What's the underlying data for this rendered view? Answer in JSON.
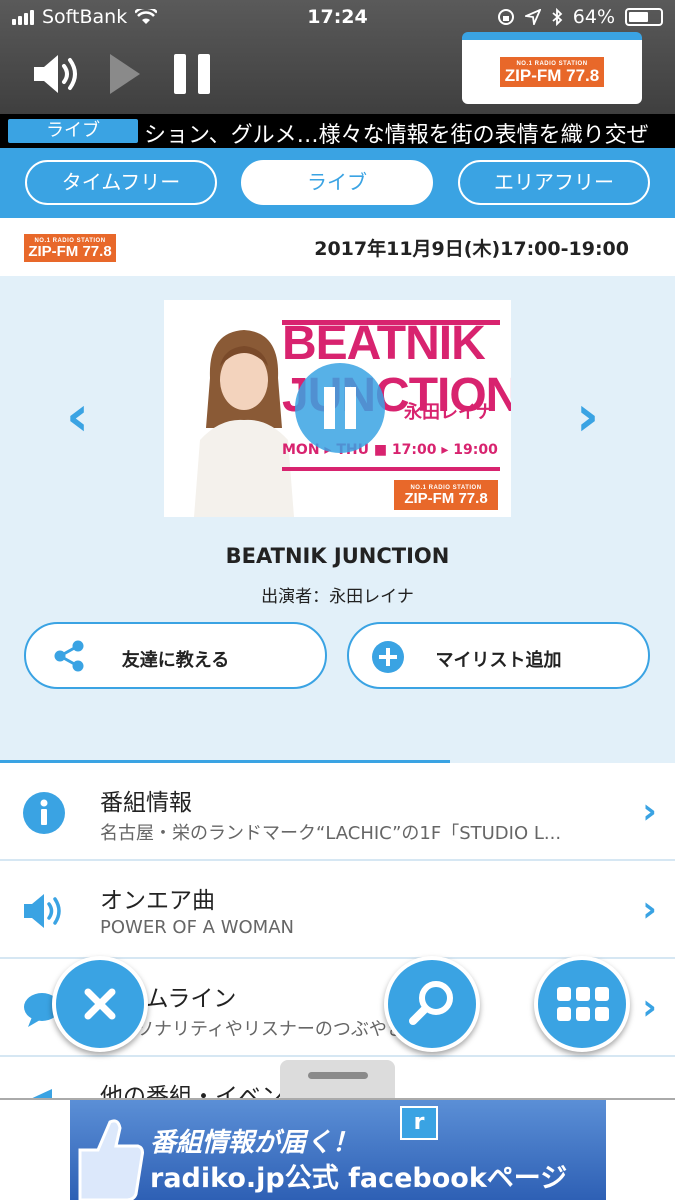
{
  "status_bar": {
    "carrier": "SoftBank",
    "time": "17:24",
    "battery": "64%",
    "battery_level": 0.64
  },
  "player": {
    "station_logo": {
      "small": "NO.1 RADIO STATION",
      "main": "ZIP-FM 77.8"
    }
  },
  "ticker": {
    "badge": "ライブ",
    "text": "ション、グルメ…様々な情報を街の表情を織り交ぜ"
  },
  "tabs": [
    {
      "label": "タイムフリー",
      "active": false
    },
    {
      "label": "ライブ",
      "active": true
    },
    {
      "label": "エリアフリー",
      "active": false
    }
  ],
  "program": {
    "station_logo": {
      "small": "NO.1 RADIO STATION",
      "main": "ZIP-FM 77.8"
    },
    "datetime": "2017年11月9日(木)17:00-19:00",
    "artwork": {
      "title_line1": "BEATNIK",
      "title_line2": "JUNCTION",
      "host": "永田レイナ",
      "schedule": "MON ▸ THU ■ 17:00 ▸ 19:00",
      "logo_small": "NO.1 RADIO STATION",
      "logo_main": "ZIP-FM 77.8"
    },
    "title": "BEATNIK JUNCTION",
    "cast": "出演者：永田レイナ",
    "share_label": "友達に教える",
    "mylist_label": "マイリスト追加"
  },
  "list": [
    {
      "title": "番組情報",
      "subtitle": "名古屋・栄のランドマーク“LACHIC”の1F「STUDIO L...",
      "icon": "info-icon"
    },
    {
      "title": "オンエア曲",
      "subtitle": "POWER OF A WOMAN",
      "icon": "speaker-icon"
    },
    {
      "title": "タイムライン",
      "subtitle": "パーソナリティやリスナーのつぶやき",
      "icon": "chat-icon"
    },
    {
      "title": "他の番組・イベント",
      "subtitle": "",
      "icon": "megaphone-icon"
    }
  ],
  "banner": {
    "line1": "番組情報が届く！",
    "line2": "radiko.jp公式 facebookページ",
    "logo": "r"
  },
  "colors": {
    "accent": "#3aa3e3",
    "brand_orange": "#e8682a",
    "artwork_pink": "#d8236f",
    "hero_bg": "#e2f0f9"
  }
}
